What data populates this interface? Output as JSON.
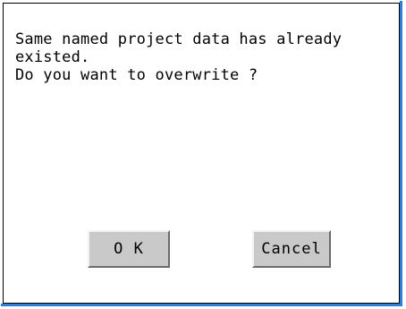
{
  "dialog": {
    "message_lines": [
      "Same named project data has already",
      "existed.",
      "Do you want to overwrite ?"
    ],
    "ok_label": "O K",
    "cancel_label": "Cancel"
  },
  "colors": {
    "accent_border": "#2f7fd8",
    "button_face": "#c9c9c9"
  }
}
